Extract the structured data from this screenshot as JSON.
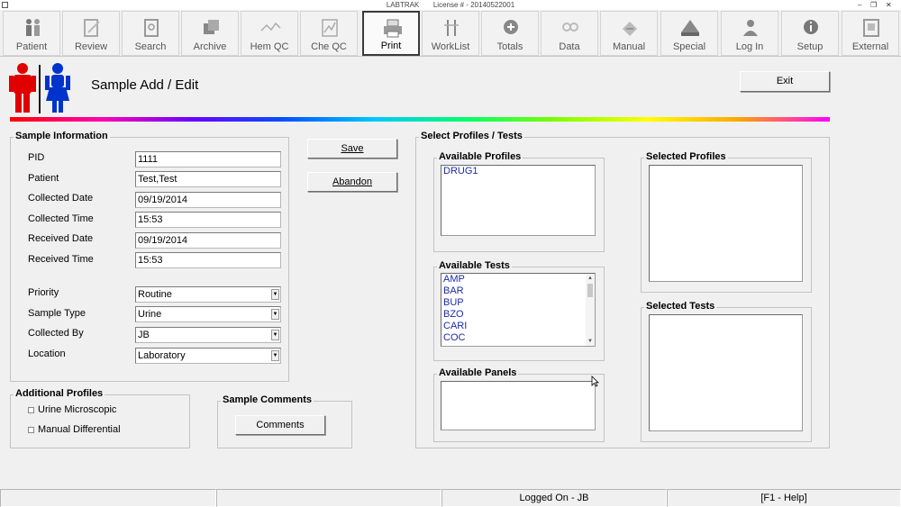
{
  "titlebar": {
    "app_name": "LABTRAK",
    "license": "License # - 20140522001"
  },
  "toolbar": {
    "items": [
      {
        "label": "Patient",
        "icon": "patient-icon"
      },
      {
        "label": "Review",
        "icon": "review-icon"
      },
      {
        "label": "Search",
        "icon": "search-icon"
      },
      {
        "label": "Archive",
        "icon": "archive-icon"
      },
      {
        "label": "Hem QC",
        "icon": "hem-qc-icon"
      },
      {
        "label": "Che QC",
        "icon": "che-qc-icon"
      },
      {
        "label": "Print",
        "icon": "print-icon",
        "active": true
      },
      {
        "label": "WorkList",
        "icon": "worklist-icon"
      },
      {
        "label": "Totals",
        "icon": "totals-icon"
      },
      {
        "label": "Data",
        "icon": "data-icon"
      },
      {
        "label": "Manual",
        "icon": "manual-icon"
      },
      {
        "label": "Special",
        "icon": "special-icon"
      },
      {
        "label": "Log In",
        "icon": "login-icon"
      },
      {
        "label": "Setup",
        "icon": "setup-icon"
      },
      {
        "label": "External",
        "icon": "external-icon"
      }
    ]
  },
  "header": {
    "title": "Sample Add / Edit",
    "exit_label": "Exit"
  },
  "sample_info": {
    "title": "Sample Information",
    "pid_label": "PID",
    "pid": "1111",
    "patient_label": "Patient",
    "patient": "Test,Test",
    "collected_date_label": "Collected Date",
    "collected_date": "09/19/2014",
    "collected_time_label": "Collected Time",
    "collected_time": "15:53",
    "received_date_label": "Received Date",
    "received_date": "09/19/2014",
    "received_time_label": "Received Time",
    "received_time": "15:53",
    "priority_label": "Priority",
    "priority": "Routine",
    "sample_type_label": "Sample Type",
    "sample_type": "Urine",
    "collected_by_label": "Collected By",
    "collected_by": "JB",
    "location_label": "Location",
    "location": "Laboratory"
  },
  "actions": {
    "save_label": "Save",
    "abandon_label": "Abandon"
  },
  "additional_profiles": {
    "title": "Additional Profiles",
    "items": [
      "Urine Microscopic",
      "Manual Differential"
    ]
  },
  "sample_comments": {
    "title": "Sample Comments",
    "button_label": "Comments"
  },
  "select_profiles": {
    "title": "Select Profiles / Tests",
    "available_profiles_title": "Available Profiles",
    "available_profiles": [
      "DRUG1"
    ],
    "available_tests_title": "Available Tests",
    "available_tests": [
      "AMP",
      "BAR",
      "BUP",
      "BZO",
      "CARI",
      "COC"
    ],
    "available_panels_title": "Available Panels",
    "selected_profiles_title": "Selected Profiles",
    "selected_tests_title": "Selected Tests"
  },
  "statusbar": {
    "logged_on": "Logged On - JB",
    "help": "[F1 - Help]"
  },
  "colors": {
    "list_text": "#1a2aa8",
    "male_icon": "#e00000",
    "female_icon": "#0033cc"
  }
}
